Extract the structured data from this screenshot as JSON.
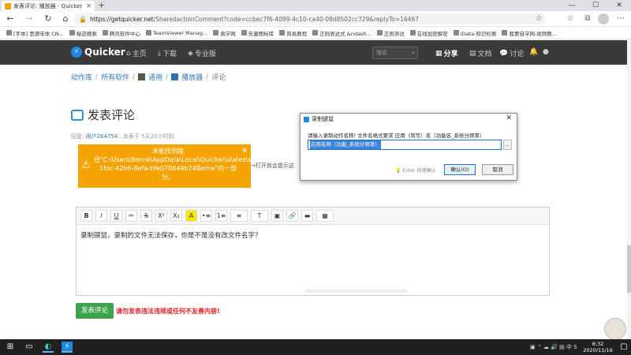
{
  "browser": {
    "tab_title": "发表评论: 播放器 - Quicker",
    "new_tab": "+",
    "url_domain": "https://getquicker.net",
    "url_path": "/SharedactionComment?code=ccbec7f6-4099-4c10-ca40-08d8502cc729&replyTo=16467",
    "bookmarks": [
      "[字体] 思源宋体 CN...",
      "秘迹搜索",
      "腾讯软件中心",
      "TeamViewer Manag...",
      "真学网",
      "矢量图标库",
      "简易教程",
      "正则表达式 &ndash...",
      "正则测试",
      "在线加密解密",
      "iData-知识检索",
      "我要自学网-视频教..."
    ]
  },
  "site_nav": {
    "logo": "Quicker",
    "home": "主页",
    "download": "下载",
    "pro": "专业版",
    "search_placeholder": "搜索",
    "share": "分享",
    "docs": "文档",
    "discuss": "讨论"
  },
  "breadcrumb": [
    "动作库",
    "所有软件",
    "通用",
    "播放器",
    "评论"
  ],
  "page": {
    "title": "发表评论",
    "reply_prefix": "回复",
    "reply_user": "用户264754",
    "reply_suffix": "...发表于 5天20小时前",
    "right_hint": "→打开就会提示这"
  },
  "warning": {
    "message": "未能找到路径\"C:\\Users\\Berne\\AppData\\Local\\Quicker\\states\\state_209345b7-1fdc-42b6-8efa-bfe070649b74Berne\"的一部分。",
    "close": "×"
  },
  "dialog": {
    "title": "录制键鼠",
    "prompt": "请输入录制动作名称!   文件名格式要求 应用（简写）名（功能名_系统分频率）",
    "value": "应用名称（功能_系统分频率）",
    "more": "...",
    "enter_hint": "Enter 快速确认",
    "ok": "确认(O)",
    "cancel": "取消",
    "close": "✕"
  },
  "editor": {
    "tools": [
      "B",
      "I",
      "U",
      "✏",
      "S",
      "X²",
      "X₂",
      "A",
      "•≡",
      "1≡",
      "≡",
      "T",
      "▣",
      "🔗",
      "▬",
      "▦"
    ],
    "content": "录制键鼠，录制的文件无法保存，你是不是没有改文件名字？"
  },
  "actions": {
    "submit": "发表评论",
    "rule": "请勿发表违法违规或任何不友善内容!"
  },
  "taskbar": {
    "time": "8:32",
    "date": "2020/11/16"
  }
}
